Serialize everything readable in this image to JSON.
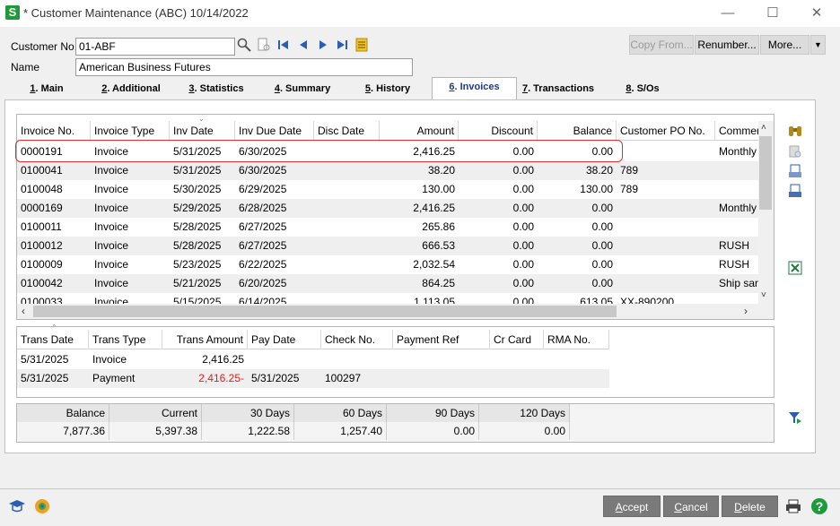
{
  "window": {
    "title": "* Customer Maintenance (ABC) 10/14/2022",
    "app_icon": "S"
  },
  "header": {
    "customer_no_label": "Customer No.",
    "customer_no_value": "01-ABF",
    "name_label": "Name",
    "name_value": "American Business Futures",
    "copy_from_label": "Copy From...",
    "renumber_label": "Renumber...",
    "more_label": "More..."
  },
  "tabs": [
    {
      "num": "1",
      "label": ". Main"
    },
    {
      "num": "2",
      "label": ". Additional"
    },
    {
      "num": "3",
      "label": ". Statistics"
    },
    {
      "num": "4",
      "label": ". Summary"
    },
    {
      "num": "5",
      "label": ". History"
    },
    {
      "num": "6",
      "label": ". Invoices"
    },
    {
      "num": "7",
      "label": ". Transactions"
    },
    {
      "num": "8",
      "label": ". S/Os"
    }
  ],
  "invoices": {
    "columns": [
      "Invoice No.",
      "Invoice Type",
      "Inv Date",
      "Inv Due Date",
      "Disc Date",
      "Amount",
      "Discount",
      "Balance",
      "Customer PO No.",
      "Commen"
    ],
    "rows": [
      [
        "0000191",
        "Invoice",
        "5/31/2025",
        "6/30/2025",
        "",
        "2,416.25",
        "0.00",
        "0.00",
        "",
        "Monthly"
      ],
      [
        "0100041",
        "Invoice",
        "5/31/2025",
        "6/30/2025",
        "",
        "38.20",
        "0.00",
        "38.20",
        "789",
        ""
      ],
      [
        "0100048",
        "Invoice",
        "5/30/2025",
        "6/29/2025",
        "",
        "130.00",
        "0.00",
        "130.00",
        "789",
        ""
      ],
      [
        "0000169",
        "Invoice",
        "5/29/2025",
        "6/28/2025",
        "",
        "2,416.25",
        "0.00",
        "0.00",
        "",
        "Monthly"
      ],
      [
        "0100011",
        "Invoice",
        "5/28/2025",
        "6/27/2025",
        "",
        "265.86",
        "0.00",
        "0.00",
        "",
        ""
      ],
      [
        "0100012",
        "Invoice",
        "5/28/2025",
        "6/27/2025",
        "",
        "666.53",
        "0.00",
        "0.00",
        "",
        "RUSH"
      ],
      [
        "0100009",
        "Invoice",
        "5/23/2025",
        "6/22/2025",
        "",
        "2,032.54",
        "0.00",
        "0.00",
        "",
        "RUSH"
      ],
      [
        "0100042",
        "Invoice",
        "5/21/2025",
        "6/20/2025",
        "",
        "864.25",
        "0.00",
        "0.00",
        "",
        "Ship san"
      ],
      [
        "0100033",
        "Invoice",
        "5/15/2025",
        "6/14/2025",
        "",
        "1,113.05",
        "0.00",
        "613.05",
        "XX-890200",
        ""
      ]
    ]
  },
  "transactions": {
    "columns": [
      "Trans Date",
      "Trans Type",
      "Trans Amount",
      "Pay Date",
      "Check No.",
      "Payment Ref",
      "Cr Card",
      "RMA No."
    ],
    "rows": [
      [
        "5/31/2025",
        "Invoice",
        "2,416.25",
        "",
        "",
        "",
        "",
        ""
      ],
      [
        "5/31/2025",
        "Payment",
        "2,416.25-",
        "5/31/2025",
        "100297",
        "",
        "",
        ""
      ]
    ]
  },
  "aging": {
    "headers": [
      "Balance",
      "Current",
      "30 Days",
      "60 Days",
      "90 Days",
      "120 Days"
    ],
    "values": [
      "7,877.36",
      "5,397.38",
      "1,222.58",
      "1,257.40",
      "0.00",
      "0.00"
    ]
  },
  "footer": {
    "accept_label": "ccept",
    "accept_u": "A",
    "cancel_label": "ancel",
    "cancel_u": "C",
    "delete_label": "elete",
    "delete_u": "D"
  },
  "colors": {
    "highlight_border": "#e23030",
    "negative_amount": "#e31b1b",
    "active_tab_text": "#1f3b8a"
  }
}
